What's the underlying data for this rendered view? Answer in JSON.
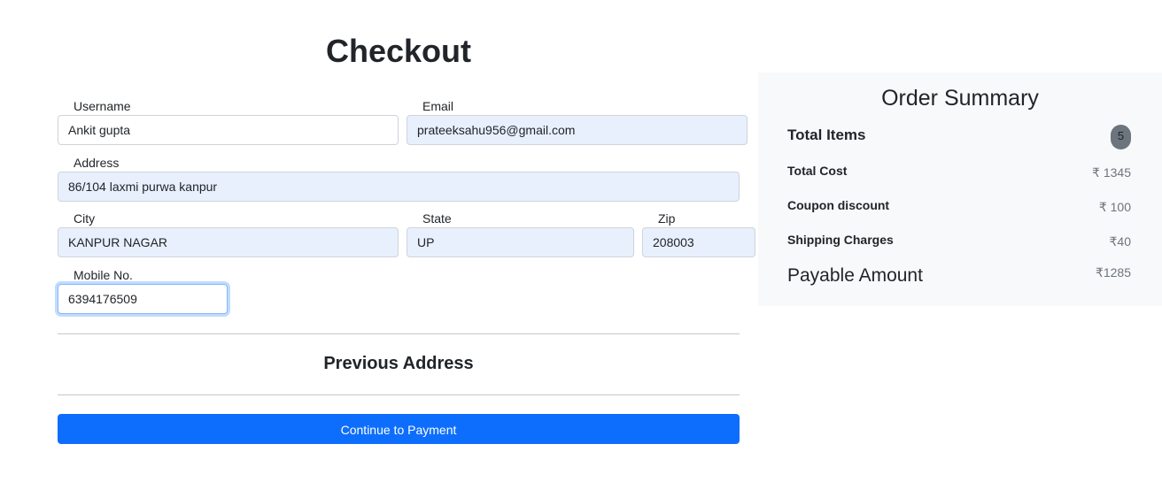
{
  "title": "Checkout",
  "form": {
    "username": {
      "label": "Username",
      "value": "Ankit gupta"
    },
    "email": {
      "label": "Email",
      "value": "prateeksahu956@gmail.com"
    },
    "address": {
      "label": "Address",
      "value": "86/104 laxmi purwa kanpur"
    },
    "city": {
      "label": "City",
      "value": "KANPUR NAGAR"
    },
    "state": {
      "label": "State",
      "value": "UP"
    },
    "zip": {
      "label": "Zip",
      "value": "208003"
    },
    "mobile": {
      "label": "Mobile No.",
      "value": "6394176509"
    }
  },
  "previous_address": "Previous Address",
  "continue_label": "Continue to Payment",
  "summary": {
    "title": "Order Summary",
    "total_items_label": "Total Items",
    "total_items": "5",
    "total_cost_label": "Total Cost",
    "total_cost": "₹ 1345",
    "coupon_label": "Coupon discount",
    "coupon": "₹ 100",
    "shipping_label": "Shipping Charges",
    "shipping": "₹40",
    "payable_label": "Payable Amount",
    "payable": "₹1285"
  }
}
